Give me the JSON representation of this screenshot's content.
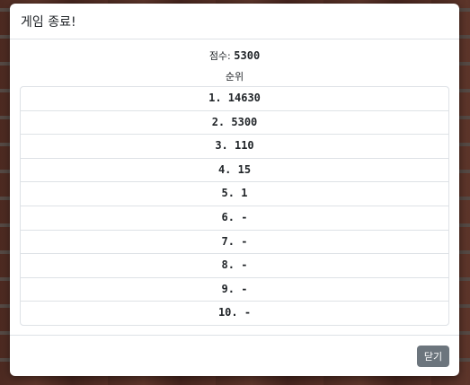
{
  "modal": {
    "title": "게임 종료!",
    "score_label": "점수: ",
    "score_value": "5300",
    "ranking_heading": "순위",
    "close_label": "닫기"
  },
  "rankings": [
    "1. 14630",
    "2. 5300",
    "3. 110",
    "4. 15",
    "5. 1",
    "6. -",
    "7. -",
    "8. -",
    "9. -",
    "10. -"
  ]
}
